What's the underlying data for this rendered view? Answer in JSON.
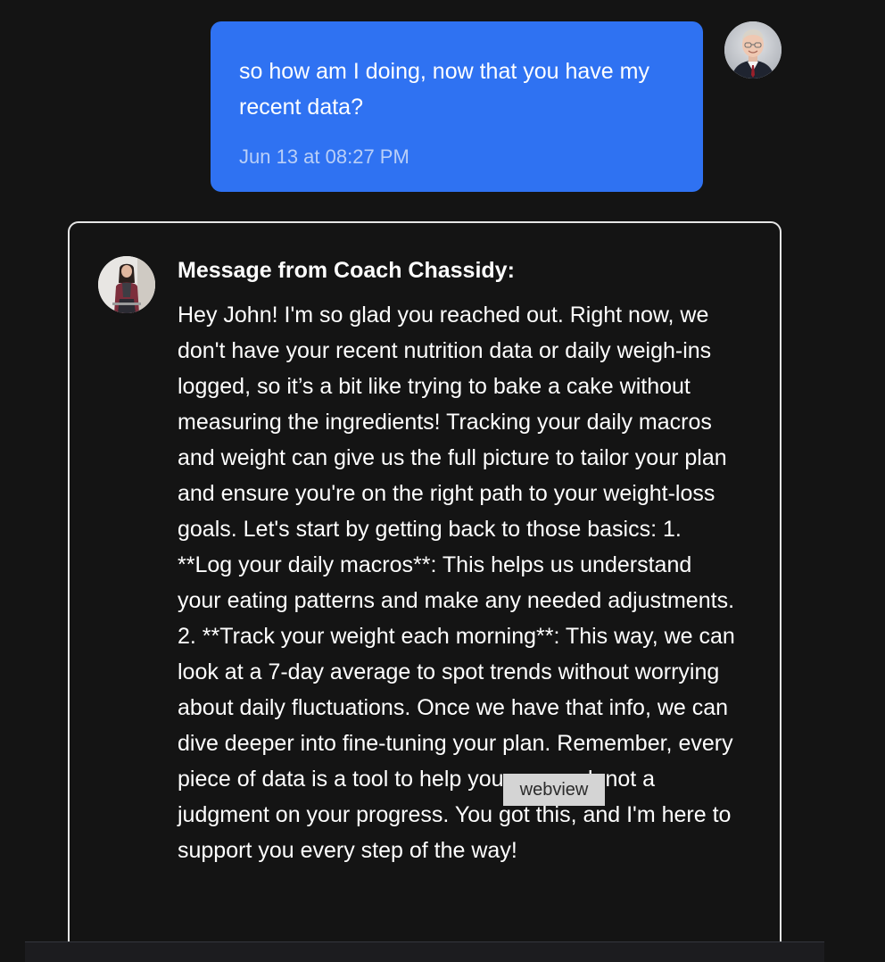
{
  "conversation": {
    "user_message": {
      "text": "so how am I doing, now that you have my recent data?",
      "timestamp": "Jun 13 at 08:27 PM",
      "bubble_color": "#2f72f2",
      "avatar_icon": "user-avatar"
    },
    "coach_message": {
      "title": "Message from Coach Chassidy:",
      "body": "Hey John! I'm so glad you reached out. Right now, we don't have your recent nutrition data or daily weigh-ins logged, so it’s a bit like trying to bake a cake without measuring the ingredients! Tracking your daily macros and weight can give us the full picture to tailor your plan and ensure you're on the right path to your weight-loss goals. Let's start by getting back to those basics: 1. **Log your daily macros**: This helps us understand your eating patterns and make any needed adjustments. 2. **Track your weight each morning**: This way, we can look at a 7-day average to spot trends without worrying about daily fluctuations. Once we have that info, we can dive deeper into fine-tuning your plan. Remember, every piece of data is a tool to help you succeed, not a judgment on your progress. You got this, and I'm here to support you every step of the way!",
      "avatar_icon": "coach-avatar"
    }
  },
  "overlay": {
    "webview_label": "webview"
  },
  "theme": {
    "background": "#141414",
    "card_border": "#e6e6e6",
    "text": "#ffffff"
  }
}
